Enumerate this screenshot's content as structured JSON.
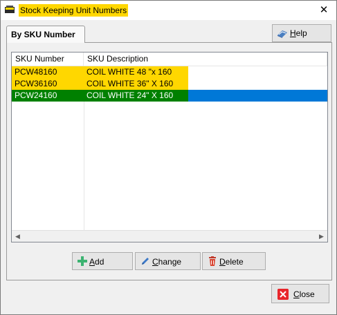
{
  "window": {
    "title": "Stock Keeping Unit Numbers",
    "close_glyph": "✕"
  },
  "tab": {
    "label": "By SKU Number"
  },
  "help": {
    "label_first": "H",
    "label_rest": "elp"
  },
  "grid": {
    "columns": [
      "SKU Number",
      "SKU Description"
    ],
    "rows": [
      {
        "sku": "PCW48160",
        "description": "COIL WHITE 48 \"x 160"
      },
      {
        "sku": "PCW36160",
        "description": "COIL WHITE 36\" X 160"
      },
      {
        "sku": "PCW24160",
        "description": "COIL WHITE 24\" X 160"
      }
    ],
    "selected_row": 2
  },
  "buttons": {
    "add": {
      "first": "A",
      "rest": "dd"
    },
    "change": {
      "first": "C",
      "rest": "hange"
    },
    "delete": {
      "first": "D",
      "rest": "elete"
    },
    "close": {
      "first": "C",
      "rest": "lose"
    }
  },
  "colors": {
    "highlight": "#ffd700",
    "selected": "#008000",
    "selection_bar": "#0078d7"
  }
}
